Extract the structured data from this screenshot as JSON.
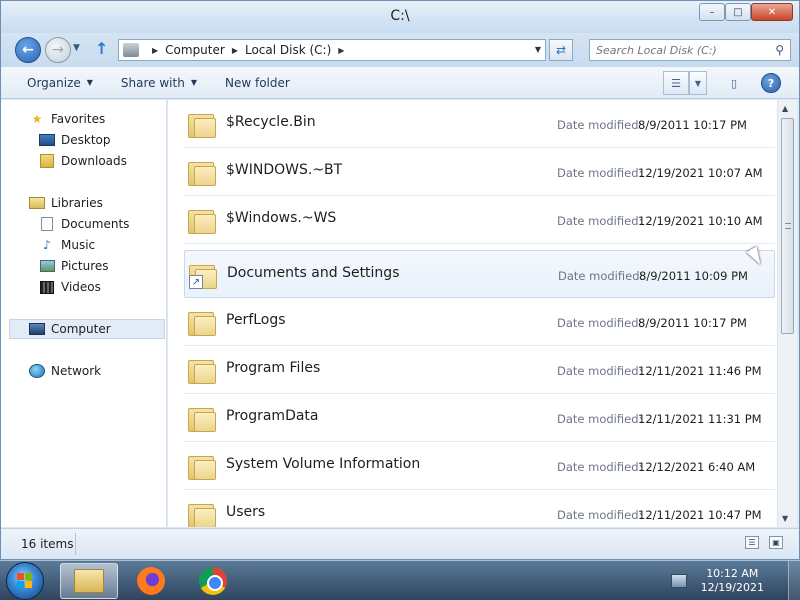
{
  "window": {
    "title": "C:\\"
  },
  "controls": {
    "minimize": "–",
    "maximize": "□",
    "close": "✕"
  },
  "address": {
    "crumbs": [
      "Computer",
      "Local Disk (C:)"
    ],
    "search_placeholder": "Search Local Disk (C:)"
  },
  "toolbar": {
    "organize": "Organize",
    "share_with": "Share with",
    "new_folder": "New folder"
  },
  "nav": {
    "favorites": "Favorites",
    "desktop": "Desktop",
    "downloads": "Downloads",
    "libraries": "Libraries",
    "documents": "Documents",
    "music": "Music",
    "pictures": "Pictures",
    "videos": "Videos",
    "computer": "Computer",
    "network": "Network"
  },
  "files": {
    "date_label": "Date modified:",
    "items": [
      {
        "name": "$Recycle.Bin",
        "date": "8/9/2011 10:17 PM"
      },
      {
        "name": "$WINDOWS.~BT",
        "date": "12/19/2021 10:07 AM"
      },
      {
        "name": "$Windows.~WS",
        "date": "12/19/2021 10:10 AM"
      },
      {
        "name": "Documents and Settings",
        "date": "8/9/2011 10:09 PM"
      },
      {
        "name": "PerfLogs",
        "date": "8/9/2011 10:17 PM"
      },
      {
        "name": "Program Files",
        "date": "12/11/2021 11:46 PM"
      },
      {
        "name": "ProgramData",
        "date": "12/11/2021 11:31 PM"
      },
      {
        "name": "System Volume Information",
        "date": "12/12/2021 6:40 AM"
      },
      {
        "name": "Users",
        "date": "12/11/2021 10:47 PM"
      }
    ]
  },
  "status": {
    "items": "16 items"
  },
  "taskbar": {
    "time": "10:12 AM",
    "date": "12/19/2021"
  }
}
